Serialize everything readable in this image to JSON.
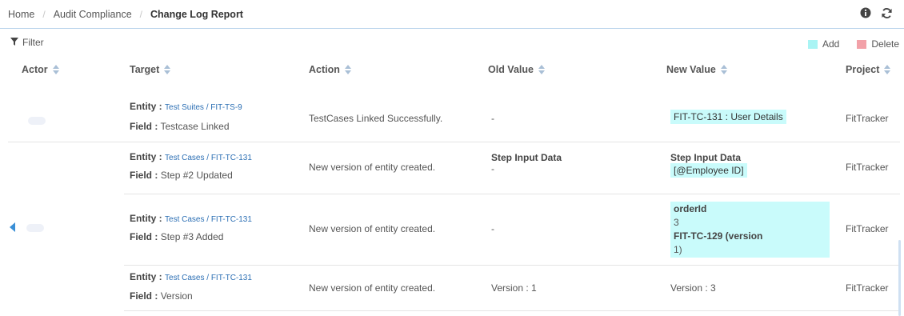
{
  "breadcrumb": {
    "items": [
      "Home",
      "Audit Compliance",
      "Change Log Report"
    ]
  },
  "toolbar": {
    "filter_label": "Filter"
  },
  "legend": {
    "add_label": "Add",
    "delete_label": "Delete",
    "add_color": "#a9f4f4",
    "delete_color": "#f2a1a8"
  },
  "columns": {
    "actor": "Actor",
    "target": "Target",
    "action": "Action",
    "old_value": "Old Value",
    "new_value": "New Value",
    "project": "Project"
  },
  "labels": {
    "entity": "Entity :",
    "field": "Field :"
  },
  "rows": [
    {
      "entity_link": "Test Suites / FIT-TS-9",
      "field": "Testcase Linked",
      "action": "TestCases Linked Successfully.",
      "old_value": "-",
      "new_value": "FIT-TC-131 : User Details",
      "project": "FitTracker"
    },
    {
      "entity_link": "Test Cases / FIT-TC-131",
      "field": "Step #2 Updated",
      "action": "New version of entity created.",
      "old_title": "Step Input Data",
      "old_value": "-",
      "new_title": "Step Input Data",
      "new_value": "[@Employee ID]",
      "project": "FitTracker"
    },
    {
      "entity_link": "Test Cases / FIT-TC-131",
      "field": "Step #3 Added",
      "action": "New version of entity created.",
      "old_value": "-",
      "new_lines": [
        "orderId",
        "3",
        "FIT-TC-129 (version",
        "1)"
      ],
      "project": "FitTracker"
    },
    {
      "entity_link": "Test Cases / FIT-TC-131",
      "field": "Version",
      "action": "New version of entity created.",
      "old_value": "Version : 1",
      "new_value": "Version : 3",
      "project": "FitTracker"
    }
  ]
}
